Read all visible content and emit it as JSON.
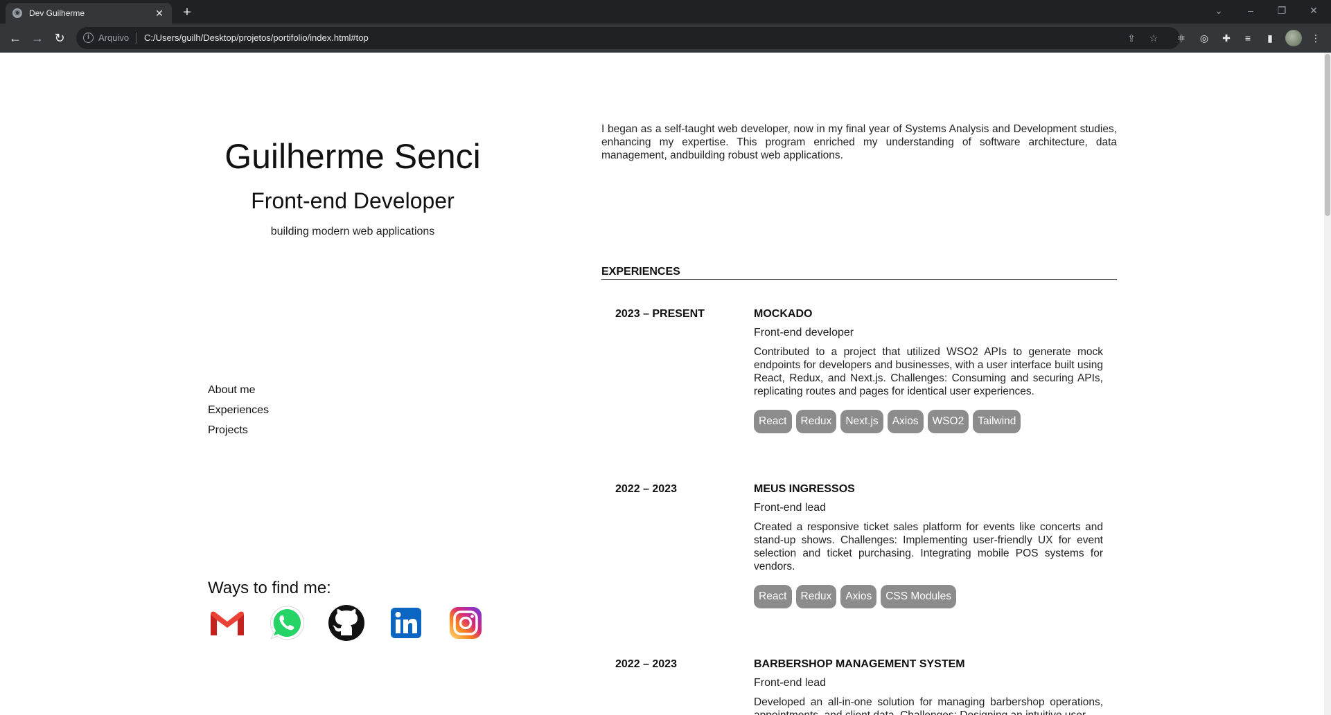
{
  "browser": {
    "tab_title": "Dev Guilherme",
    "new_tab": "+",
    "scheme_label": "Arquivo",
    "url": "C:/Users/guilh/Desktop/projetos/portifolio/index.html#top"
  },
  "hero": {
    "name": "Guilherme Senci",
    "role": "Front-end Developer",
    "tagline": "building modern web applications"
  },
  "nav": {
    "items": [
      "About me",
      "Experiences",
      "Projects"
    ]
  },
  "find": {
    "heading": "Ways to find me:",
    "icons": [
      "gmail-icon",
      "whatsapp-icon",
      "github-icon",
      "linkedin-icon",
      "instagram-icon"
    ]
  },
  "about": {
    "text": "I began as a self-taught web developer, now in my final year of Systems Analysis and Development studies, enhancing my expertise. This program enriched my understanding of software architecture, data management, andbuilding robust web applications."
  },
  "experiences": {
    "heading": "EXPERIENCES",
    "items": [
      {
        "period": "2023 – PRESENT",
        "company": "MOCKADO",
        "position": "Front-end developer",
        "description": "Contributed to a project that utilized WSO2 APIs to generate mock endpoints for developers and businesses, with a user interface built using React, Redux, and Next.js. Challenges: Consuming and securing APIs, replicating routes and pages for identical user experiences.",
        "tags": [
          "React",
          "Redux",
          "Next.js",
          "Axios",
          "WSO2",
          "Tailwind"
        ]
      },
      {
        "period": "2022 – 2023",
        "company": "MEUS INGRESSOS",
        "position": "Front-end lead",
        "description": "Created a responsive ticket sales platform for events like concerts and stand-up shows. Challenges: Implementing user-friendly UX for event selection and ticket purchasing. Integrating mobile POS systems for vendors.",
        "tags": [
          "React",
          "Redux",
          "Axios",
          "CSS Modules"
        ]
      },
      {
        "period": "2022 – 2023",
        "company": "BARBERSHOP MANAGEMENT SYSTEM",
        "position": "Front-end lead",
        "description": "Developed an all-in-one solution for managing barbershop operations, appointments, and client data. Challenges: Designing an intuitive user",
        "tags": []
      }
    ]
  },
  "colors": {
    "chip_bg": "#8c8c8c",
    "chrome_dark": "#202124",
    "chrome_mid": "#35363a"
  }
}
